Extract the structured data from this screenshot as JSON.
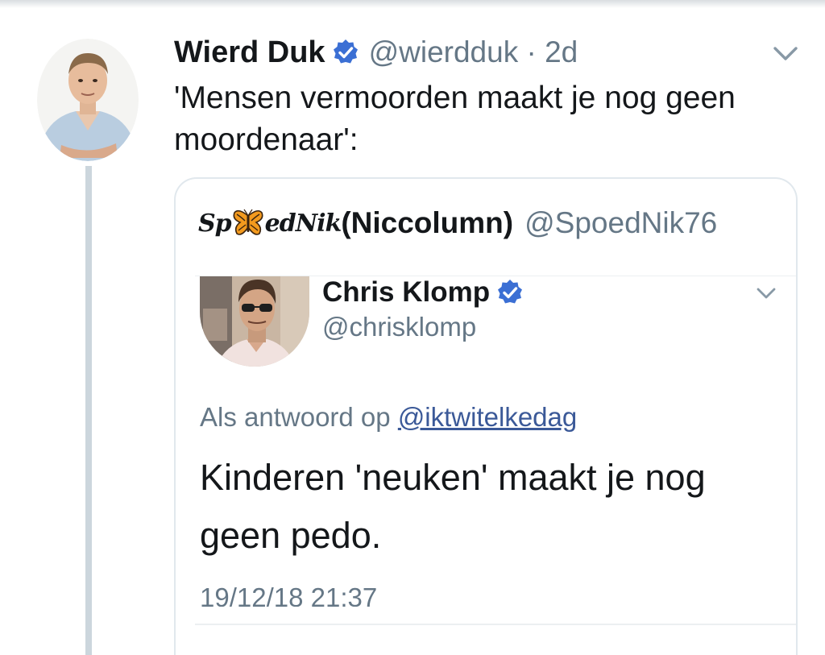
{
  "tweet": {
    "author_name": "Wierd Duk",
    "author_handle": "@wierdduk",
    "separator": "·",
    "time_ago": "2d",
    "text": "'Mensen vermoorden maakt je nog geen moordenaar':",
    "verified_icon": "verified-badge-icon",
    "menu_icon": "chevron-down-icon"
  },
  "quote": {
    "display_prefix_left": "Sp",
    "display_prefix_right": "edNik",
    "display_name": "(Niccolumn)",
    "handle": "@SpoedNik76",
    "ornament_icon": "butterfly-icon",
    "embedded": {
      "author_name": "Chris Klomp",
      "author_handle": "@chrisklomp",
      "reply_label": "Als antwoord op",
      "reply_handle": "@iktwitelkedag",
      "text": "Kinderen 'neuken' maakt je nog geen pedo.",
      "timestamp": "19/12/18 21:37",
      "verified_icon": "verified-badge-icon",
      "menu_icon": "chevron-down-icon"
    }
  },
  "colors": {
    "text_primary": "#14171a",
    "text_secondary": "#657786",
    "verified_blue": "#1da1f2",
    "verified_blue_dark": "#3b6fd4",
    "link": "#3b5998",
    "thread_line": "#ccd6dd",
    "card_border": "#e1e8ed"
  }
}
